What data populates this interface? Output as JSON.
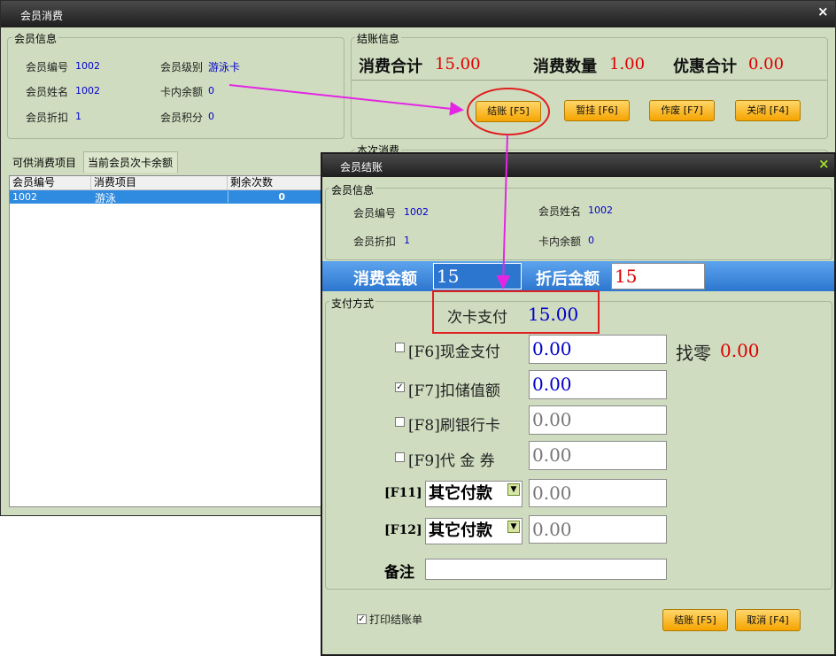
{
  "colors": {
    "accent_red": "#dd0000",
    "value_blue": "#0000cc",
    "annotation_magenta": "#e426e4",
    "annotation_red": "#e02020",
    "button_orange": "#f5a400"
  },
  "main_window": {
    "title": "会员消费",
    "close_icon": "×",
    "member_info": {
      "legend": "会员信息",
      "member_no_label": "会员编号",
      "member_no": "1002",
      "member_level_label": "会员级别",
      "member_level": "游泳卡",
      "member_name_label": "会员姓名",
      "member_name": "1002",
      "card_balance_label": "卡内余额",
      "card_balance": "0",
      "discount_label": "会员折扣",
      "discount": "1",
      "points_label": "会员积分",
      "points": "0"
    },
    "checkout_info": {
      "legend": "结账信息",
      "total_label": "消费合计",
      "total": "15.00",
      "qty_label": "消费数量",
      "qty": "1.00",
      "discount_total_label": "优惠合计",
      "discount_total": "0.00"
    },
    "buttons": {
      "checkout": "结账 [F5]",
      "suspend": "暂挂 [F6]",
      "void": "作废 [F7]",
      "close": "关闭 [F4]"
    },
    "this_consumption_legend": "本次消费",
    "tabs": [
      "可供消费项目",
      "当前会员次卡余额"
    ],
    "table": {
      "columns": [
        "会员编号",
        "消费项目",
        "剩余次数"
      ],
      "rows": [
        {
          "member_no": "1002",
          "item": "游泳",
          "remaining": "0"
        }
      ]
    }
  },
  "checkout_dialog": {
    "title": "会员结账",
    "close_icon": "×",
    "member_info": {
      "legend": "会员信息",
      "member_no_label": "会员编号",
      "member_no": "1002",
      "member_name_label": "会员姓名",
      "member_name": "1002",
      "discount_label": "会员折扣",
      "discount": "1",
      "card_balance_label": "卡内余额",
      "card_balance": "0"
    },
    "amount_label": "消费金额",
    "amount": "15",
    "after_discount_label": "折后金额",
    "after_discount": "15",
    "payment": {
      "legend": "支付方式",
      "card_pay_label": "次卡支付",
      "card_pay": "15.00",
      "cash_label": "[F6]现金支付",
      "cash": "0.00",
      "cash_checked": false,
      "change_label": "找零",
      "change": "0.00",
      "stored_label": "[F7]扣储值额",
      "stored": "0.00",
      "stored_checked": true,
      "bank_label": "[F8]刷银行卡",
      "bank": "0.00",
      "bank_checked": false,
      "voucher_label": "[F9]代 金 券",
      "voucher": "0.00",
      "voucher_checked": false,
      "f11_label": "[F11]",
      "f11_option": "其它付款",
      "f11_value": "0.00",
      "f12_label": "[F12]",
      "f12_option": "其它付款",
      "f12_value": "0.00",
      "note_label": "备注",
      "note": ""
    },
    "print_label": "打印结账单",
    "print_checked": true,
    "buttons": {
      "checkout": "结账 [F5]",
      "cancel": "取消 [F4]"
    }
  }
}
